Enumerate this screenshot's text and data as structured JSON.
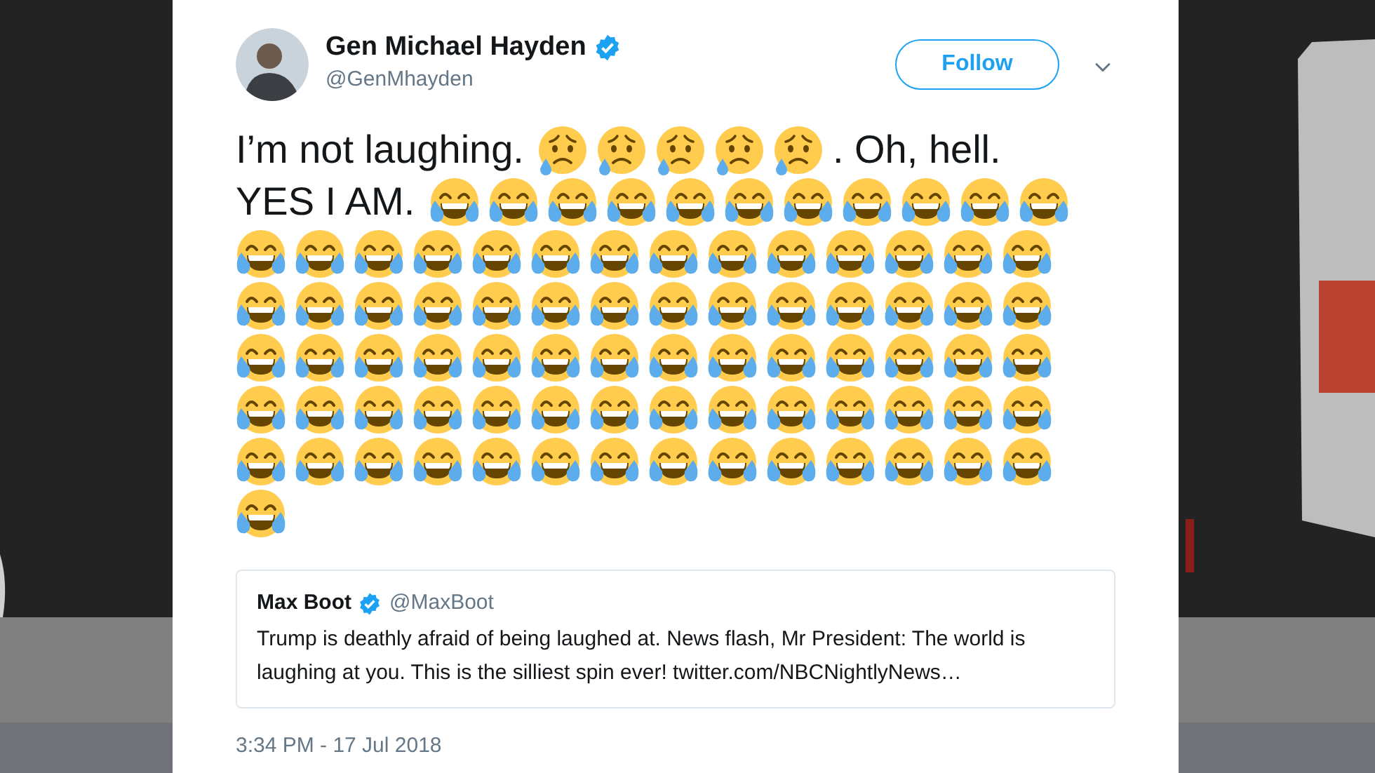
{
  "tweet": {
    "author": {
      "name": "Gen Michael Hayden",
      "verified": true,
      "handle": "@GenMhayden"
    },
    "follow_button": "Follow",
    "lines": [
      [
        {
          "kind": "text",
          "text": "I’m not laughing."
        },
        {
          "kind": "sad_emoji"
        },
        {
          "kind": "sad_emoji"
        },
        {
          "kind": "sad_emoji"
        },
        {
          "kind": "sad_emoji"
        },
        {
          "kind": "sad_emoji"
        },
        {
          "kind": "text",
          "text": ". Oh, hell."
        }
      ],
      [
        {
          "kind": "text",
          "text": "YES I AM."
        },
        {
          "kind": "laughing_emoji"
        },
        {
          "kind": "laughing_emoji"
        },
        {
          "kind": "laughing_emoji"
        },
        {
          "kind": "laughing_emoji"
        },
        {
          "kind": "laughing_emoji"
        },
        {
          "kind": "laughing_emoji"
        },
        {
          "kind": "laughing_emoji"
        },
        {
          "kind": "laughing_emoji"
        },
        {
          "kind": "laughing_emoji"
        },
        {
          "kind": "laughing_emoji"
        },
        {
          "kind": "laughing_emoji"
        }
      ],
      [
        {
          "kind": "laughing_emoji"
        },
        {
          "kind": "laughing_emoji"
        },
        {
          "kind": "laughing_emoji"
        },
        {
          "kind": "laughing_emoji"
        },
        {
          "kind": "laughing_emoji"
        },
        {
          "kind": "laughing_emoji"
        },
        {
          "kind": "laughing_emoji"
        },
        {
          "kind": "laughing_emoji"
        },
        {
          "kind": "laughing_emoji"
        },
        {
          "kind": "laughing_emoji"
        },
        {
          "kind": "laughing_emoji"
        },
        {
          "kind": "laughing_emoji"
        },
        {
          "kind": "laughing_emoji"
        },
        {
          "kind": "laughing_emoji"
        }
      ],
      [
        {
          "kind": "laughing_emoji"
        },
        {
          "kind": "laughing_emoji"
        },
        {
          "kind": "laughing_emoji"
        },
        {
          "kind": "laughing_emoji"
        },
        {
          "kind": "laughing_emoji"
        },
        {
          "kind": "laughing_emoji"
        },
        {
          "kind": "laughing_emoji"
        },
        {
          "kind": "laughing_emoji"
        },
        {
          "kind": "laughing_emoji"
        },
        {
          "kind": "laughing_emoji"
        },
        {
          "kind": "laughing_emoji"
        },
        {
          "kind": "laughing_emoji"
        },
        {
          "kind": "laughing_emoji"
        },
        {
          "kind": "laughing_emoji"
        }
      ],
      [
        {
          "kind": "laughing_emoji"
        },
        {
          "kind": "laughing_emoji"
        },
        {
          "kind": "laughing_emoji"
        },
        {
          "kind": "laughing_emoji"
        },
        {
          "kind": "laughing_emoji"
        },
        {
          "kind": "laughing_emoji"
        },
        {
          "kind": "laughing_emoji"
        },
        {
          "kind": "laughing_emoji"
        },
        {
          "kind": "laughing_emoji"
        },
        {
          "kind": "laughing_emoji"
        },
        {
          "kind": "laughing_emoji"
        },
        {
          "kind": "laughing_emoji"
        },
        {
          "kind": "laughing_emoji"
        },
        {
          "kind": "laughing_emoji"
        }
      ],
      [
        {
          "kind": "laughing_emoji"
        },
        {
          "kind": "laughing_emoji"
        },
        {
          "kind": "laughing_emoji"
        },
        {
          "kind": "laughing_emoji"
        },
        {
          "kind": "laughing_emoji"
        },
        {
          "kind": "laughing_emoji"
        },
        {
          "kind": "laughing_emoji"
        },
        {
          "kind": "laughing_emoji"
        },
        {
          "kind": "laughing_emoji"
        },
        {
          "kind": "laughing_emoji"
        },
        {
          "kind": "laughing_emoji"
        },
        {
          "kind": "laughing_emoji"
        },
        {
          "kind": "laughing_emoji"
        },
        {
          "kind": "laughing_emoji"
        }
      ],
      [
        {
          "kind": "laughing_emoji"
        },
        {
          "kind": "laughing_emoji"
        },
        {
          "kind": "laughing_emoji"
        },
        {
          "kind": "laughing_emoji"
        },
        {
          "kind": "laughing_emoji"
        },
        {
          "kind": "laughing_emoji"
        },
        {
          "kind": "laughing_emoji"
        },
        {
          "kind": "laughing_emoji"
        },
        {
          "kind": "laughing_emoji"
        },
        {
          "kind": "laughing_emoji"
        },
        {
          "kind": "laughing_emoji"
        },
        {
          "kind": "laughing_emoji"
        },
        {
          "kind": "laughing_emoji"
        },
        {
          "kind": "laughing_emoji"
        }
      ],
      [
        {
          "kind": "laughing_emoji"
        }
      ]
    ],
    "quoted_tweet": {
      "name": "Max Boot",
      "verified": true,
      "handle": "@MaxBoot",
      "text": "Trump is deathly afraid of being laughed at. News flash, Mr President: The world is laughing at you. This is the silliest spin ever! twitter.com/NBCNightlyNews…"
    },
    "timestamp": "3:34 PM - 17 Jul 2018"
  }
}
